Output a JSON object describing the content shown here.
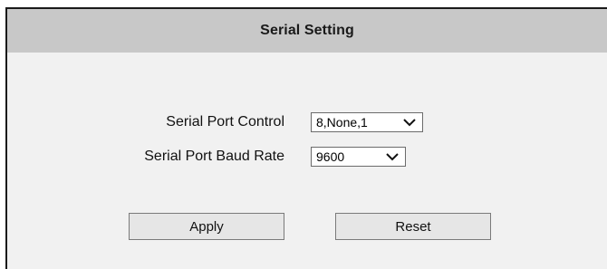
{
  "header": {
    "title": "Serial Setting"
  },
  "form": {
    "serial_port_control": {
      "label": "Serial Port Control",
      "value": "8,None,1"
    },
    "serial_port_baud_rate": {
      "label": "Serial Port Baud Rate",
      "value": "9600"
    }
  },
  "actions": {
    "apply_label": "Apply",
    "reset_label": "Reset"
  },
  "icons": {
    "dropdown": "chevron-down-icon"
  }
}
